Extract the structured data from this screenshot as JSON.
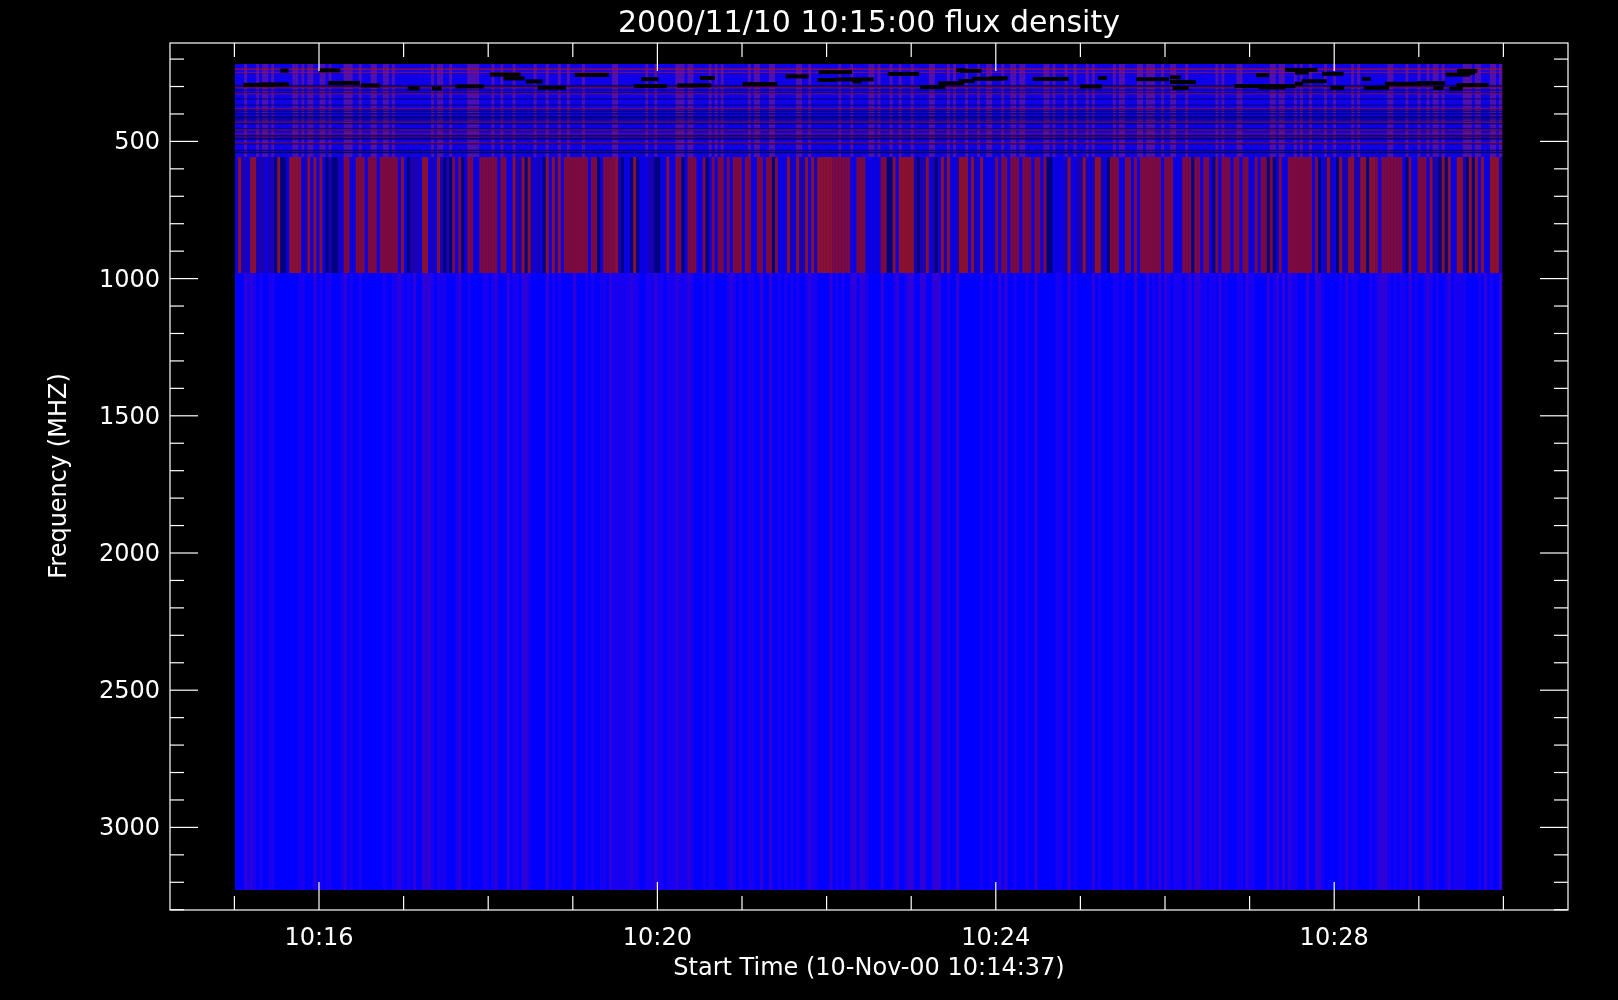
{
  "title": "2000/11/10 10:15:00 flux density",
  "ylabel": "Frequency (MHZ)",
  "xlabel": "Start Time (10-Nov-00 10:14:37)",
  "yticks": [
    "500",
    "1000",
    "1500",
    "2000",
    "2500",
    "3000"
  ],
  "xticks": [
    "10:16",
    "10:20",
    "10:24",
    "10:28"
  ]
}
